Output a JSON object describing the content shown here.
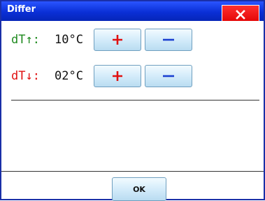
{
  "window": {
    "title": "Differ"
  },
  "rows": [
    {
      "label": "dT↑:",
      "value": "10°C",
      "label_color": "#1f8a1f"
    },
    {
      "label": "dT↓:",
      "value": "02°C",
      "label_color": "#e01010"
    }
  ],
  "buttons": {
    "ok_label": "OK"
  },
  "icons": {
    "close": "close-icon",
    "plus": "plus-icon",
    "minus": "minus-icon"
  },
  "colors": {
    "title_bar": "#0a2fd6",
    "close_button": "#e00000",
    "plus_sign": "#e01010",
    "minus_sign": "#1a3fd0"
  }
}
